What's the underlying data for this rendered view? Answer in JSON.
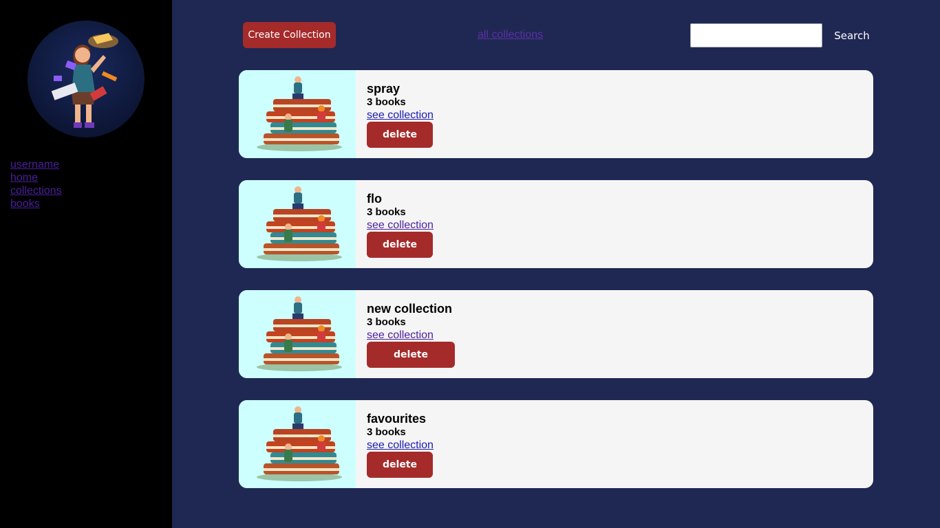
{
  "sidebar": {
    "links": [
      "username",
      "home",
      "collections",
      "books"
    ]
  },
  "header": {
    "create_label": "Create Collection",
    "all_label": "all collections",
    "search_value": "",
    "search_label": "Search"
  },
  "collections": [
    {
      "title": "spray",
      "count": "3 books",
      "link": "see collection",
      "delete": "delete"
    },
    {
      "title": "flo",
      "count": "3 books",
      "link": "see collection",
      "delete": "delete"
    },
    {
      "title": "new collection",
      "count": "3 books",
      "link": "see collection",
      "delete": "delete"
    },
    {
      "title": "favourites",
      "count": "3 books",
      "link": "see collection",
      "delete": "delete"
    }
  ],
  "colors": {
    "sidebar_bg": "#000000",
    "main_bg": "#1f2853",
    "accent": "#a52a2a",
    "card_bg": "#f5f5f5",
    "image_bg": "#ccfffe"
  }
}
